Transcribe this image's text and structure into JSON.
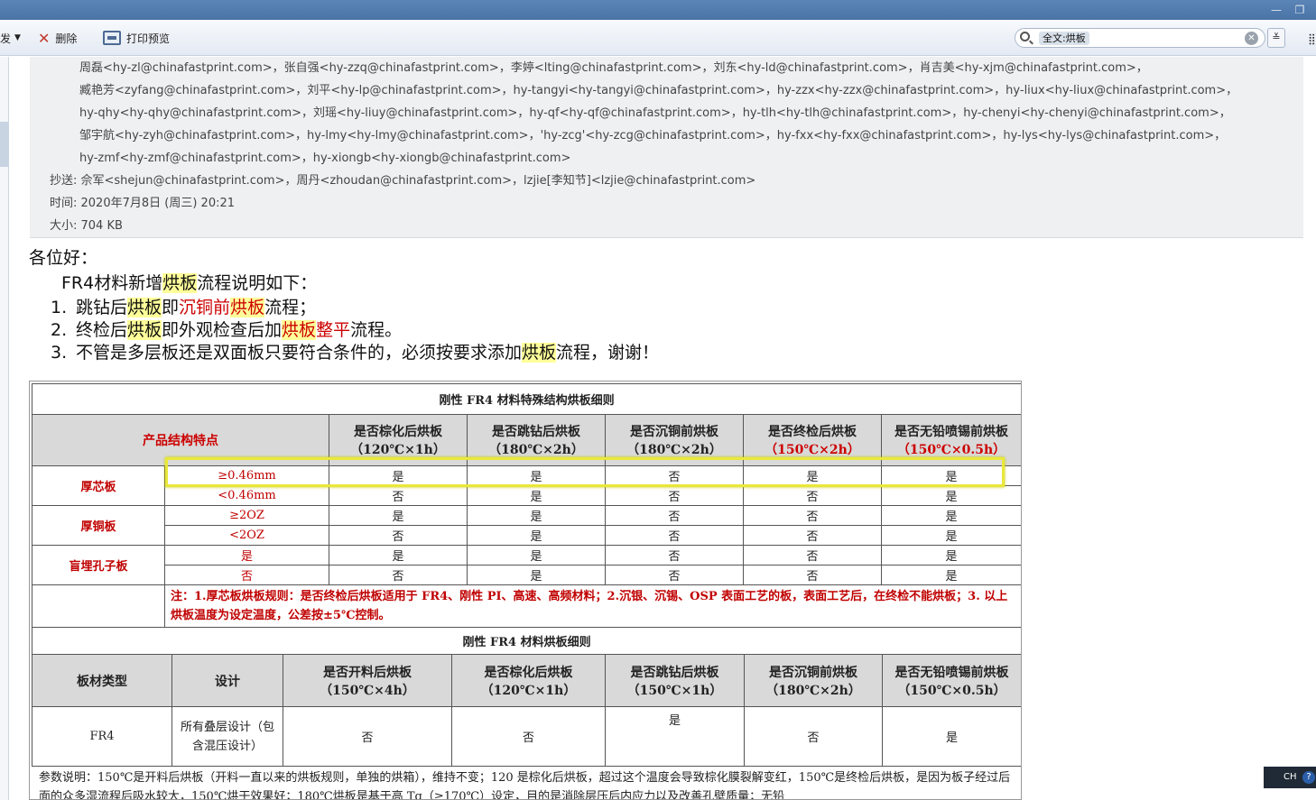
{
  "toolbar": {
    "send_fragment": "发",
    "delete_label": "删除",
    "print_label": "打印预览",
    "search_tag": "全文:烘板"
  },
  "header": {
    "recipients_lines": [
      "周磊<hy-zl@chinafastprint.com>，张自强<hy-zzq@chinafastprint.com>，李婷<lting@chinafastprint.com>，刘东<hy-ld@chinafastprint.com>，肖吉美<hy-xjm@chinafastprint.com>，",
      "臧艳芳<zyfang@chinafastprint.com>，刘平<hy-lp@chinafastprint.com>，hy-tangyi<hy-tangyi@chinafastprint.com>，hy-zzx<hy-zzx@chinafastprint.com>，hy-liux<hy-liux@chinafastprint.com>，",
      "hy-qhy<hy-qhy@chinafastprint.com>，刘瑶<hy-liuy@chinafastprint.com>，hy-qf<hy-qf@chinafastprint.com>，hy-tlh<hy-tlh@chinafastprint.com>，hy-chenyi<hy-chenyi@chinafastprint.com>，",
      "邹宇航<hy-zyh@chinafastprint.com>，hy-lmy<hy-lmy@chinafastprint.com>，'hy-zcg'<hy-zcg@chinafastprint.com>，hy-fxx<hy-fxx@chinafastprint.com>，hy-lys<hy-lys@chinafastprint.com>，",
      "hy-zmf<hy-zmf@chinafastprint.com>，hy-xiongb<hy-xiongb@chinafastprint.com>"
    ],
    "cc": "抄送: 佘军<shejun@chinafastprint.com>，周丹<zhoudan@chinafastprint.com>，lzjie[李知节]<lzjie@chinafastprint.com>",
    "time": "时间: 2020年7月8日 (周三) 20:21",
    "size": "大小: 704 KB"
  },
  "body": {
    "greeting": "各位好：",
    "intro_pre": "FR4材料新增",
    "intro_hl": "烘板",
    "intro_post": "流程说明如下：",
    "items": [
      {
        "num": "1.",
        "a": "跳钻后",
        "b": "烘板",
        "c": "即",
        "d": "沉铜前",
        "e": "烘板",
        "f": "流程；"
      },
      {
        "num": "2.",
        "a": "终检后",
        "b": "烘板",
        "c": "即外观检查后加",
        "d": "烘板",
        "e": "整平",
        "f": "流程。"
      },
      {
        "num": "3.",
        "a": "不管是多层板还是双面板只要符合条件的，必须按要求添加",
        "b": "烘板",
        "c": "流程，谢谢！"
      }
    ]
  },
  "table1": {
    "title": "刚性 FR4 材料特殊结构烘板细则",
    "col0": "产品结构特点",
    "cols": [
      [
        "是否棕化后烘板",
        "（120℃×1h）"
      ],
      [
        "是否跳钻后烘板",
        "（180℃×2h）"
      ],
      [
        "是否沉铜前烘板",
        "（180℃×2h）"
      ],
      [
        "是否终检后烘板",
        "（150℃×2h）"
      ],
      [
        "是否无铅喷锡前烘板",
        "（150℃×0.5h）"
      ]
    ],
    "groups": [
      {
        "name": "厚芯板",
        "rows": [
          {
            "cond": "≥0.46mm",
            "vals": [
              "是",
              "是",
              "否",
              "是",
              "是"
            ]
          },
          {
            "cond": "<0.46mm",
            "vals": [
              "否",
              "是",
              "否",
              "否",
              "是"
            ]
          }
        ]
      },
      {
        "name": "厚铜板",
        "rows": [
          {
            "cond": "≥2OZ",
            "vals": [
              "是",
              "是",
              "否",
              "否",
              "是"
            ]
          },
          {
            "cond": "<2OZ",
            "vals": [
              "否",
              "是",
              "否",
              "否",
              "是"
            ]
          }
        ]
      },
      {
        "name": "盲埋孔子板",
        "rows": [
          {
            "cond": "是",
            "vals": [
              "是",
              "是",
              "否",
              "否",
              "是"
            ]
          },
          {
            "cond": "否",
            "vals": [
              "否",
              "是",
              "否",
              "否",
              "是"
            ]
          }
        ]
      }
    ],
    "note": "注：1.厚芯板烘板规则：是否终检后烘板适用于 FR4、刚性 PI、高速、高频材料；2.沉银、沉锡、OSP 表面工艺的板，表面工艺后，在终检不能烘板；3. 以上烘板温度为设定温度，公差按±5℃控制。"
  },
  "table2": {
    "title": "刚性 FR4 材料烘板细则",
    "headers": [
      "板材类型",
      "设计",
      "是否开料后烘板（150℃×4h）",
      "是否棕化后烘板（120℃×1h）",
      "是否跳钻后烘板（150℃×1h）",
      "是否沉铜前烘板（180℃×2h）",
      "是否无铅喷锡前烘板（150℃×0.5h）"
    ],
    "row": [
      "FR4",
      "所有叠层设计（包含混压设计）",
      "否",
      "否",
      "是",
      "否",
      "是"
    ],
    "param": "参数说明：150℃是开料后烘板（开料一直以来的烘板规则，单独的烘箱），维持不变；120 是棕化后烘板，超过这个温度会导致棕化膜裂解变红，150℃是终检后烘板，是因为板子经过后面的众多湿流程后吸水较大，150℃烘干效果好；180℃烘板是基于高 Tg（≥170℃）设定，目的是消除层压后内应力以及改善孔壁质量；无铅"
  },
  "status": {
    "ime": "CH",
    "help": "?"
  }
}
